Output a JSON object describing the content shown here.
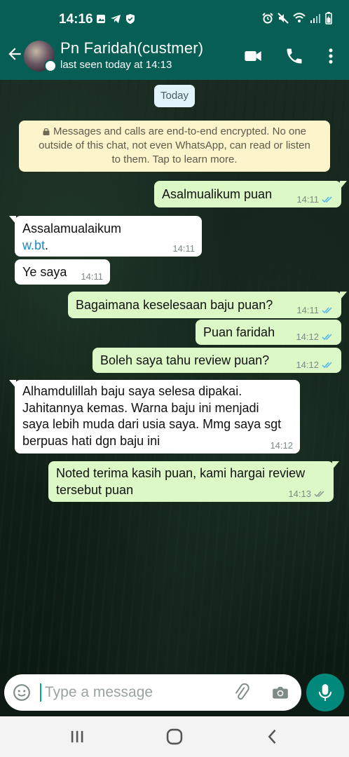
{
  "status_bar": {
    "time": "14:16"
  },
  "header": {
    "contact_name": "Pn Faridah(custmer)",
    "last_seen": "last seen today at 14:13"
  },
  "chat": {
    "date_chip": "Today",
    "encryption_notice": {
      "line1": "Messages and calls are end-to-end encrypted. No one",
      "line2": "outside of this chat, not even WhatsApp, can read or listen",
      "line3": "to them. Tap to learn more."
    },
    "messages": [
      {
        "direction": "out",
        "text": "Asalmualikum puan",
        "time": "14:11",
        "status": "read"
      },
      {
        "direction": "in",
        "line1": "Assalamualaikum",
        "link": "w.bt",
        "after_link": ".",
        "time": "14:11"
      },
      {
        "direction": "in",
        "text": "Ye saya",
        "time": "14:11"
      },
      {
        "direction": "out",
        "text": "Bagaimana keselesaan baju puan?",
        "time": "14:11",
        "status": "read"
      },
      {
        "direction": "out",
        "text": "Puan faridah",
        "time": "14:12",
        "status": "read"
      },
      {
        "direction": "out",
        "text": "Boleh saya tahu review puan?",
        "time": "14:12",
        "status": "read"
      },
      {
        "direction": "in",
        "line1": "Alhamdulillah baju saya selesa dipakai.",
        "line2": "Jahitannya kemas. Warna baju ini menjadi",
        "line3": "saya lebih muda dari usia saya. Mmg saya sgt",
        "line4": "berpuas hati dgn baju ini",
        "time": "14:12"
      },
      {
        "direction": "out",
        "line1": "Noted terima kasih puan, kami hargai review",
        "line2": "tersebut puan",
        "time": "14:13",
        "status": "delivered"
      }
    ]
  },
  "composer": {
    "placeholder": "Type a message"
  },
  "icons": {
    "back": "arrow-left-icon",
    "video": "video-call-icon",
    "call": "phone-icon",
    "menu": "more-vert-icon",
    "emoji": "emoji-icon",
    "attach": "paperclip-icon",
    "camera": "camera-icon",
    "mic": "mic-icon"
  },
  "colors": {
    "header": "#075e54",
    "outgoing_bubble": "#dcf8c6",
    "incoming_bubble": "#ffffff",
    "read_tick": "#4fb6ec",
    "mic_button": "#00897b",
    "notice": "#fcf4cb"
  }
}
